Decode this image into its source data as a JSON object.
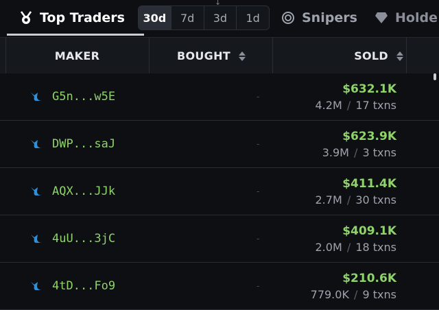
{
  "tabs": {
    "top_traders": "Top Traders",
    "snipers": "Snipers",
    "holders": "Holde"
  },
  "periods": [
    "30d",
    "7d",
    "3d",
    "1d"
  ],
  "active_period": "30d",
  "columns": {
    "maker": "MAKER",
    "bought": "BOUGHT",
    "sold": "SOLD"
  },
  "rows": [
    {
      "maker": "G5n...w5E",
      "bought": "-",
      "sold": "$632.1K",
      "amount": "4.2M",
      "sep": "/",
      "txns": "17 txns"
    },
    {
      "maker": "DWP...saJ",
      "bought": "-",
      "sold": "$623.9K",
      "amount": "3.9M",
      "sep": "/",
      "txns": "3 txns"
    },
    {
      "maker": "AQX...JJk",
      "bought": "-",
      "sold": "$411.4K",
      "amount": "2.7M",
      "sep": "/",
      "txns": "30 txns"
    },
    {
      "maker": "4uU...3jC",
      "bought": "-",
      "sold": "$409.1K",
      "amount": "2.0M",
      "sep": "/",
      "txns": "18 txns"
    },
    {
      "maker": "4tD...Fo9",
      "bought": "-",
      "sold": "$210.6K",
      "amount": "779.0K",
      "sep": "/",
      "txns": "9 txns"
    }
  ],
  "colors": {
    "accent_green": "#8fd36b",
    "whale_blue": "#2f8fd8",
    "background": "#0d0f13"
  },
  "icons": {
    "top_traders": "trophy-medal-icon",
    "snipers": "target-icon",
    "holders": "diamond-icon",
    "maker": "whale-icon"
  }
}
